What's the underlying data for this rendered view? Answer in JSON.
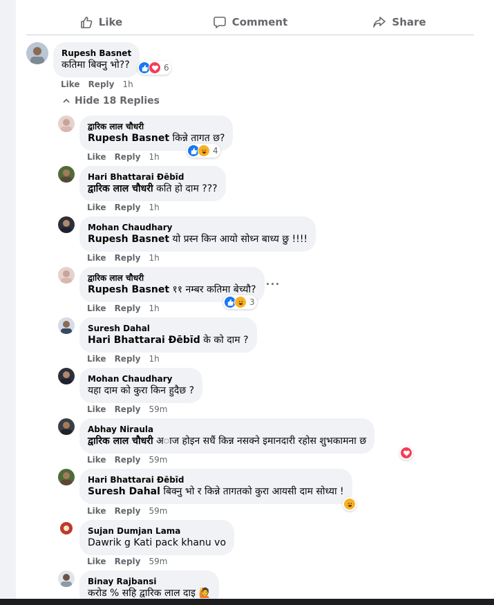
{
  "actions": {
    "like": "Like",
    "comment": "Comment",
    "share": "Share"
  },
  "meta": {
    "like": "Like",
    "reply": "Reply"
  },
  "hide_replies": "Hide 18 Replies",
  "comments": [
    {
      "name": "Rupesh Basnet",
      "mention": "",
      "text": "कतिमा बिक्नु भो??",
      "time": "1h",
      "reactions": [
        "like",
        "love"
      ],
      "count": "6"
    },
    {
      "name": "द्वारिक लाल चौधरी",
      "mention": "Rupesh Basnet",
      "text": " किन्ने तागत छ?",
      "time": "1h",
      "reactions": [
        "like",
        "haha"
      ],
      "count": "4"
    },
    {
      "name": "Hari Bhattarai Đēbīd",
      "mention": "द्वारिक लाल चौधरी",
      "text": " कति हो दाम ???",
      "time": "1h",
      "reactions": [],
      "count": ""
    },
    {
      "name": "Mohan Chaudhary",
      "mention": "Rupesh Basnet",
      "text": " यो प्रस्न किन आयो सोध्न बाध्य छु !!!!",
      "time": "1h",
      "reactions": [],
      "count": ""
    },
    {
      "name": "द्वारिक लाल चौधरी",
      "mention": "Rupesh Basnet",
      "text": " ११ नम्बर कतिमा बेच्यौ?",
      "time": "1h",
      "reactions": [
        "like",
        "haha"
      ],
      "count": "3"
    },
    {
      "name": "Suresh Dahal",
      "mention": "Hari Bhattarai Đēbīd",
      "text": " के को दाम ?",
      "time": "1h",
      "reactions": [],
      "count": ""
    },
    {
      "name": "Mohan Chaudhary",
      "mention": "",
      "text": "यहा दाम को कुरा किन हुदैछ ?",
      "time": "59m",
      "reactions": [],
      "count": ""
    },
    {
      "name": "Abhay Niraula",
      "mention": "द्वारिक लाल चौधरी",
      "text": " अ◌ाज होइन सधैं किन्न नसक्ने इमानदारी रहोस शुभकामना छ",
      "time": "59m",
      "reactions": [
        "love"
      ],
      "count": ""
    },
    {
      "name": "Hari Bhattarai Đēbīd",
      "mention": "Suresh Dahal",
      "text": " बिक्नु भो र किन्ने तागतको कुरा आयसी दाम सोध्या !",
      "time": "59m",
      "reactions": [
        "haha"
      ],
      "count": ""
    },
    {
      "name": "Sujan Dumjan Lama",
      "mention": "",
      "text": "Dawrik g Kati pack khanu vo",
      "time": "59m",
      "reactions": [],
      "count": ""
    },
    {
      "name": "Binay Rajbansi",
      "mention": "",
      "text": "करोड % सहि द्वारिक लाल दाइ 🙋",
      "time": "",
      "reactions": [],
      "count": ""
    }
  ],
  "colors": {
    "like": "#1877f2",
    "love": "#f33e58",
    "haha": "#f7b125",
    "meta": "#65676b",
    "bubble": "#f0f2f5"
  }
}
